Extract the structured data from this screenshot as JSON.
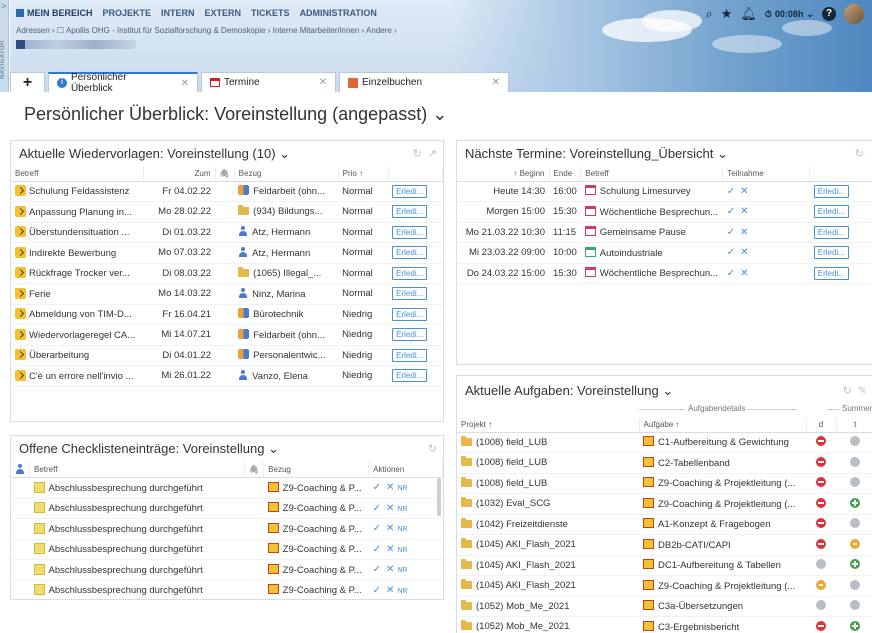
{
  "nav": {
    "label": "NAVIGATOR",
    "arrow": ">"
  },
  "menu": {
    "items": [
      "MEIN BEREICH",
      "PROJEKTE",
      "INTERN",
      "EXTERN",
      "TICKETS",
      "ADMINISTRATION"
    ]
  },
  "breadcrumb": "Adressen › ☐ Apollis OHG - Institut für Sozialforschung & Demoskopie › Interne Mitarbeiter/innen › Andere ›",
  "toolbar": {
    "timer": "00:08h"
  },
  "tabs": [
    "Persönlicher Überblick",
    "Termine",
    "Einzelbuchen"
  ],
  "page_title": "Persönlicher Überblick: Voreinstellung (angepasst) ⌄",
  "wiedervorlagen": {
    "title": "Aktuelle Wiedervorlagen: Voreinstellung (10) ⌄",
    "headers": {
      "betreff": "Betreff",
      "zum": "Zum",
      "bezug": "Bezug",
      "prio": "Prio ↑"
    },
    "erl": "Erledi...",
    "rows": [
      {
        "betreff": "Schulung Feldassistenz",
        "zum": "Fr 04.02.22",
        "bezug": "Feldarbeit (ohn...",
        "bezug_icon": "team",
        "prio": "Normal"
      },
      {
        "betreff": "Anpassung Planung in...",
        "zum": "Mo 28.02.22",
        "bezug": "(934) Bildungs...",
        "bezug_icon": "folder",
        "prio": "Normal"
      },
      {
        "betreff": "Überstundensituation ...",
        "zum": "Di 01.03.22",
        "bezug": "Atz, Hermann",
        "bezug_icon": "person",
        "prio": "Normal"
      },
      {
        "betreff": "Indirekte Bewerbung",
        "zum": "Mo 07.03.22",
        "bezug": "Atz, Hermann",
        "bezug_icon": "person",
        "prio": "Normal"
      },
      {
        "betreff": "Rückfrage Trocker ver...",
        "zum": "Di 08.03.22",
        "bezug": "(1065) Illegal_...",
        "bezug_icon": "folder",
        "prio": "Normal"
      },
      {
        "betreff": "Ferie",
        "zum": "Mo 14.03.22",
        "bezug": "Ninz, Marina",
        "bezug_icon": "person",
        "prio": "Normal"
      },
      {
        "betreff": "Abmeldung von TIM-D...",
        "zum": "Fr 16.04.21",
        "bezug": "Bürotechnik",
        "bezug_icon": "team",
        "prio": "Niedrig"
      },
      {
        "betreff": "Wiedervorlageregel CA...",
        "zum": "Mi 14.07.21",
        "bezug": "Feldarbeit (ohn...",
        "bezug_icon": "team",
        "prio": "Niedrig"
      },
      {
        "betreff": "Überarbeitung",
        "zum": "Di 04.01.22",
        "bezug": "Personalentwic...",
        "bezug_icon": "team",
        "prio": "Niedrig"
      },
      {
        "betreff": "C'è un errore nell'invio ...",
        "zum": "Mi 26.01.22",
        "bezug": "Vanzo, Elena",
        "bezug_icon": "person",
        "prio": "Niedrig"
      }
    ]
  },
  "checklisten": {
    "title": "Offene Checklisteneinträge: Voreinstellung ⌄",
    "headers": {
      "betreff": "Betreff",
      "bezug": "Bezug",
      "aktionen": "Aktionen"
    },
    "nr": "NR",
    "rows": [
      {
        "betreff": "Abschlussbesprechung durchgeführt",
        "bezug": "Z9-Coaching & P..."
      },
      {
        "betreff": "Abschlussbesprechung durchgeführt",
        "bezug": "Z9-Coaching & P..."
      },
      {
        "betreff": "Abschlussbesprechung durchgeführt",
        "bezug": "Z9-Coaching & P..."
      },
      {
        "betreff": "Abschlussbesprechung durchgeführt",
        "bezug": "Z9-Coaching & P..."
      },
      {
        "betreff": "Abschlussbesprechung durchgeführt",
        "bezug": "Z9-Coaching & P..."
      },
      {
        "betreff": "Abschlussbesprechung durchgeführt",
        "bezug": "Z9-Coaching & P..."
      }
    ]
  },
  "termine": {
    "title": "Nächste Termine: Voreinstellung_Übersicht ⌄",
    "headers": {
      "beginn": "↑ Beginn",
      "ende": "Ende",
      "betreff": "Betreff",
      "teilnahme": "Teilnahme"
    },
    "erl": "Erledi...",
    "rows": [
      {
        "beginn": "Heute 14:30",
        "ende": "16:00",
        "betreff": "Schulung Limesurvey",
        "icon": "event"
      },
      {
        "beginn": "Morgen 15:00",
        "ende": "15:30",
        "betreff": "Wöchentliche Besprechun...",
        "icon": "event"
      },
      {
        "beginn": "Mo 21.03.22 10:30",
        "ende": "11:15",
        "betreff": "Gemeinsame Pause",
        "icon": "event"
      },
      {
        "beginn": "Mi 23.03.22 09:00",
        "ende": "10:00",
        "betreff": "Autoindustriale",
        "icon": "event2"
      },
      {
        "beginn": "Do 24.03.22 15:00",
        "ende": "15:30",
        "betreff": "Wöchentliche Besprechun...",
        "icon": "event"
      }
    ]
  },
  "aufgaben": {
    "title": "Aktuelle Aufgaben: Voreinstellung ⌄",
    "group_headers": {
      "details": "Aufgabendetails",
      "summen": "Summen"
    },
    "headers": {
      "projekt": "Projekt ↑",
      "aufgabe": "Aufgabe ↑",
      "d": "d",
      "t": "t"
    },
    "rows": [
      {
        "projekt": "(1008) field_LUB",
        "aufgabe": "C1-Aufbereitung & Gewichtung",
        "d": "minus",
        "t": "grey"
      },
      {
        "projekt": "(1008) field_LUB",
        "aufgabe": "C2-Tabellenband",
        "d": "minus",
        "t": "grey"
      },
      {
        "projekt": "(1008) field_LUB",
        "aufgabe": "Z9-Coaching & Projektleitung (...",
        "d": "minus",
        "t": "grey"
      },
      {
        "projekt": "(1032) Eval_SCG",
        "aufgabe": "Z9-Coaching & Projektleitung (...",
        "d": "minus",
        "t": "plus"
      },
      {
        "projekt": "(1042) Freizeitdienste",
        "aufgabe": "A1-Konzept & Fragebogen",
        "d": "minus",
        "t": "grey"
      },
      {
        "projekt": "(1045) AKI_Flash_2021",
        "aufgabe": "DB2b-CATI/CAPI",
        "d": "minus",
        "t": "orange"
      },
      {
        "projekt": "(1045) AKI_Flash_2021",
        "aufgabe": "DC1-Aufbereitung & Tabellen",
        "d": "grey",
        "t": "plus"
      },
      {
        "projekt": "(1045) AKI_Flash_2021",
        "aufgabe": "Z9-Coaching & Projektleitung (...",
        "d": "orange",
        "t": "grey"
      },
      {
        "projekt": "(1052) Mob_Me_2021",
        "aufgabe": "C3a-Übersetzungen",
        "d": "grey",
        "t": "grey"
      },
      {
        "projekt": "(1052) Mob_Me_2021",
        "aufgabe": "C3-Ergebnisbericht",
        "d": "minus",
        "t": "plus"
      }
    ]
  }
}
